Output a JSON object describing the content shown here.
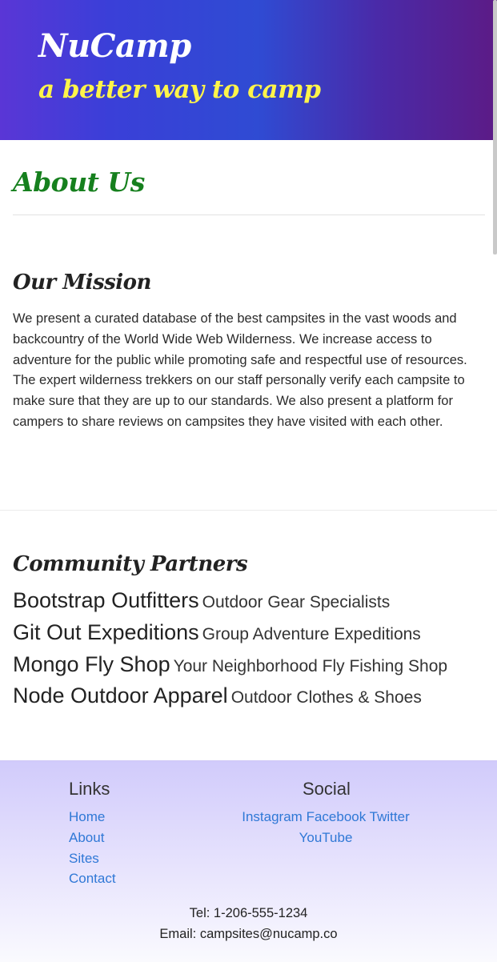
{
  "header": {
    "brand": "NuCamp",
    "tagline": "a better way to camp"
  },
  "about": {
    "title": "About Us"
  },
  "mission": {
    "title": "Our Mission",
    "text": "We present a curated database of the best campsites in the vast woods and backcountry of the World Wide Web Wilderness. We increase access to adventure for the public while promoting safe and respectful use of resources. The expert wilderness trekkers on our staff personally verify each campsite to make sure that they are up to our standards. We also present a platform for campers to share reviews on campsites they have visited with each other."
  },
  "partners": {
    "title": "Community Partners",
    "items": [
      {
        "name": "Bootstrap Outfitters",
        "desc": "Outdoor Gear Specialists"
      },
      {
        "name": "Git Out Expeditions",
        "desc": "Group Adventure Expeditions"
      },
      {
        "name": "Mongo Fly Shop",
        "desc": "Your Neighborhood Fly Fishing Shop"
      },
      {
        "name": "Node Outdoor Apparel",
        "desc": "Outdoor Clothes & Shoes"
      }
    ]
  },
  "footer": {
    "links_heading": "Links",
    "links": [
      "Home",
      "About",
      "Sites",
      "Contact"
    ],
    "social_heading": "Social",
    "social": [
      "Instagram",
      "Facebook",
      "Twitter",
      "YouTube"
    ],
    "tel": "Tel: 1-206-555-1234",
    "email": "Email: campsites@nucamp.co"
  },
  "colors": {
    "accent_green": "#16801e",
    "tagline_yellow": "#fff44a",
    "link_blue": "#2f78d6"
  }
}
